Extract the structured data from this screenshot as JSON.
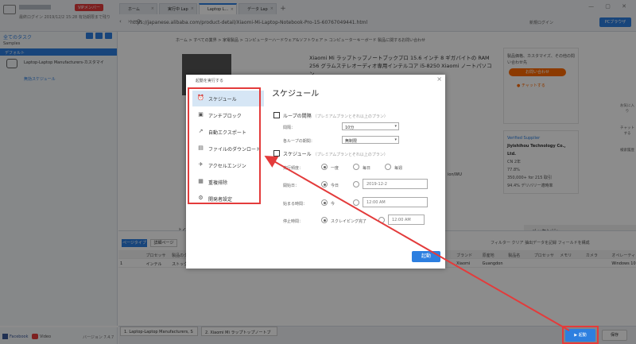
{
  "app": {
    "account_badge": "VIPメンバー",
    "account_sub": "最終ログイン 2019/12/2 15:28  有効期限まで残り",
    "tabs": [
      {
        "label": "ホーム"
      },
      {
        "label": "実行中 Lap"
      },
      {
        "label": "Laptop L..."
      },
      {
        "label": "データ Lap"
      }
    ],
    "url": "https://japanese.alibaba.com/product-detail/Xiaomi-Mi-Laptop-Notebook-Pro-15-60767049441.html",
    "login_link": "新規ログイン",
    "pc_button": "PCブラウザ"
  },
  "left_panel": {
    "title": "全てのタスク",
    "tree_samples": "Samples",
    "tree_default": "デフォルト",
    "task1": "Laptop-Laptop Manufacturers-カスタマイ",
    "task2": "無効スケジュール"
  },
  "webpage": {
    "breadcrumb": "ホーム > すべての業界 > 家電製品 > コンピューターハードウェア&ソフトウェア > コンピューターキーボード  製品に関するお問い合わせ",
    "product_title": "Xiaomi Mi ラップトップノートブックプロ 15.6 インチ 8 ギガバイトの RAM 256 グラムステレオーディオ専用インテルコア i5-8250 Xiaomi ノートパソコン",
    "side_text": "製品価格、カスタマイズ、その他の問い合わせ先",
    "side_button": "お問い合わせ",
    "side_chat": "● チャットする",
    "supplier_title": "Verified Supplier",
    "supplier_name": "Jiyishihou Technology Co., Ltd.",
    "supplier_country": "CN  2年",
    "supplier_rate": "77.8%",
    "supplier_revenue": "350,000+ for 215 取引",
    "supplier_ontime": "94.4% デリバリー適時率",
    "model_label": "ion/WU",
    "section_label": "よく",
    "messenger": "メッセンジャー",
    "right_rail": [
      "お気に入り",
      "チャットする",
      "検索履歴"
    ]
  },
  "bottom": {
    "tab1": "ページタイプ",
    "tab2": "詳細ページ",
    "tools": "フィルター  クリア  抽出データを記録  フィールドを構成",
    "headers": [
      "",
      "プロセッサ",
      "製品のタイ",
      "",
      "",
      "",
      "",
      "",
      "",
      "",
      "",
      "",
      "出荷地",
      "ブランド",
      "原産地",
      "製品名",
      "プロセッサ",
      "メモリ",
      "カメラ",
      "オペレーティ"
    ],
    "rows": [
      [
        "1",
        "インテル",
        "ストック",
        "",
        "",
        "",
        "",
        "",
        "",
        "",
        "",
        "",
        "China",
        "Xiaomi",
        "Guangdon",
        "",
        "",
        "",
        "",
        "Windows 10"
      ]
    ]
  },
  "status": {
    "tab1": "1. Laptop-Laptop Manufacturers, S",
    "tab2": "2. Xiaomi Mi ラップトップノートブ",
    "run_button": "▶ 起動",
    "save_button": "保存"
  },
  "modal": {
    "title": "起動を実行する",
    "heading": "スケジュール",
    "nav": [
      {
        "label": "スケジュール",
        "icon": "alarm-clock-icon",
        "glyph": "⏰"
      },
      {
        "label": "アンチブロック",
        "icon": "shield-icon",
        "glyph": "▣"
      },
      {
        "label": "自動エクスポート",
        "icon": "export-icon",
        "glyph": "↗"
      },
      {
        "label": "ファイルのダウンロード",
        "icon": "download-icon",
        "glyph": "▤"
      },
      {
        "label": "アクセルエンジン",
        "icon": "rocket-icon",
        "glyph": "✈"
      },
      {
        "label": "重複排除",
        "icon": "dedupe-icon",
        "glyph": "▦"
      },
      {
        "label": "開発者設定",
        "icon": "gear-icon",
        "glyph": "⚙"
      }
    ],
    "loop": {
      "label": "ループの間隔",
      "hint": "（プレミアムプランとそれ以上のプラン）",
      "interval_label": "間隔：",
      "interval_value": "10分",
      "each_label": "各ループの期間：",
      "each_value": "無制限"
    },
    "schedule": {
      "label": "スケジュール",
      "hint": "（プレミアムプランとそれ以上のプラン）",
      "freq_label": "実行頻度：",
      "freq_options": [
        "一度",
        "毎日",
        "毎週"
      ],
      "start_date_label": "開始日：",
      "start_date_today": "今日",
      "start_date_value": "2019-12-2",
      "start_time_label": "始まる時間：",
      "start_time_now": "今",
      "start_time_value": "12:00 AM",
      "stop_time_label": "停止時間：",
      "stop_time_option": "スクレイピング完了",
      "stop_time_value": "12:00 AM"
    },
    "ok_button": "起動"
  },
  "colors": {
    "accent": "#2d7fe0",
    "highlight": "#e33b3b",
    "nav_active": "#d6e6f5"
  }
}
